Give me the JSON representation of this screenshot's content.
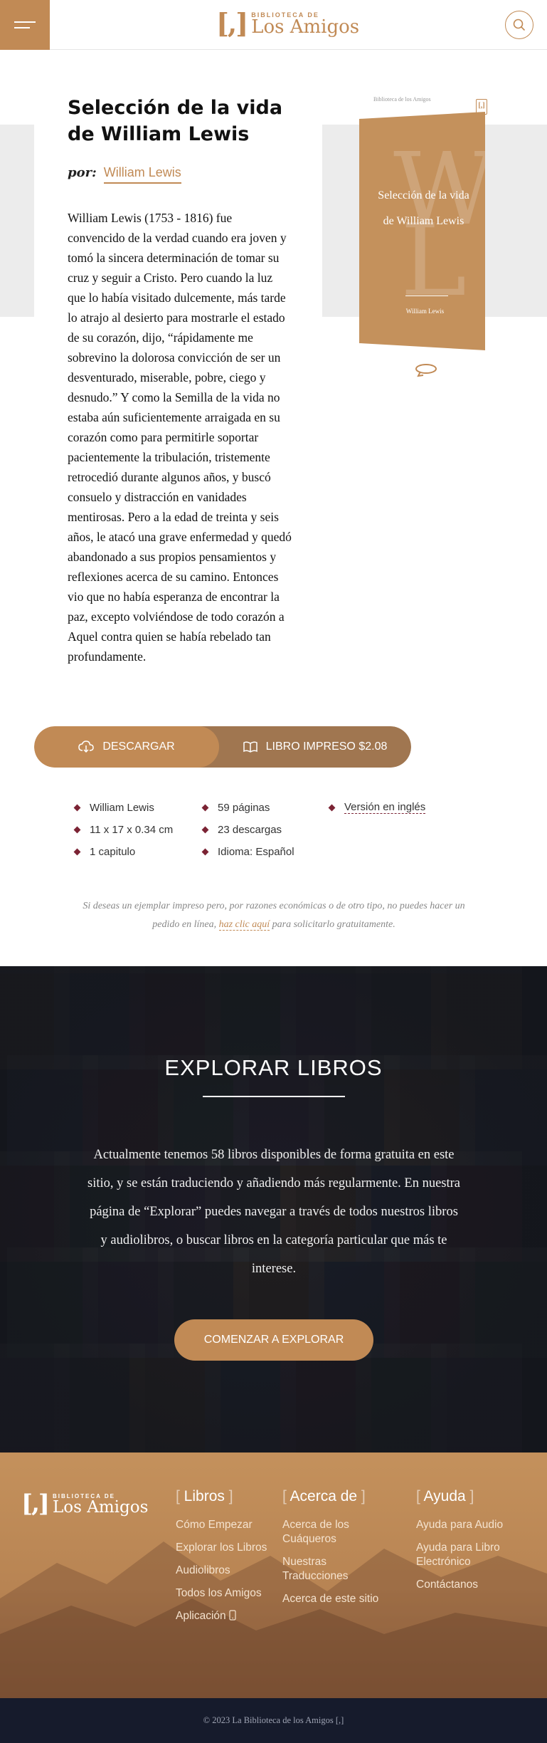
{
  "brand": {
    "small": "BIBLIOTECA DE",
    "big": "Los Amigos",
    "mark": "[,]",
    "color": "#c18a55"
  },
  "book": {
    "title": "Selección de la vida de William Lewis",
    "by": "por:",
    "author": "William Lewis",
    "description": "William Lewis (1753 - 1816) fue convencido de la verdad cuando era joven y tomó la sincera determinación de tomar su cruz y seguir a Cristo. Pero cuando la luz que lo había visitado dulcemente, más tarde lo atrajo al desierto para mostrarle el estado de su corazón, dijo, “rápidamente me sobrevino la dolorosa convicción de ser un desventurado, miserable, pobre, ciego y desnudo.” Y como la Semilla de la vida no estaba aún suficientemente arraigada en su corazón como para permitirle soportar pacientemente la tribulación, tristemente retrocedió durante algunos años, y buscó consuelo y distracción en vanidades mentirosas. Pero a la edad de treinta y seis años, le atacó una grave enfermedad y quedó abandonado a sus propios pensamientos y reflexiones acerca de su camino. Entonces vio que no había esperanza de encontrar la paz, excepto volviéndose de todo corazón a Aquel contra quien se había rebelado tan profundamente."
  },
  "cover": {
    "spine_text": "Biblioteca de los Amigos",
    "title": "Selección de la vida de William Lewis",
    "author": "William Lewis",
    "ghost_letters": [
      "W",
      "L"
    ]
  },
  "actions": {
    "download": "DESCARGAR",
    "print": "LIBRO IMPRESO $2.08"
  },
  "meta": [
    {
      "text": "William Lewis",
      "link": false
    },
    {
      "text": "59 páginas",
      "link": false
    },
    {
      "text": "Versión en inglés",
      "link": true
    },
    {
      "text": "11 x 17 x 0.34 cm",
      "link": false
    },
    {
      "text": "23 descargas",
      "link": false
    },
    {
      "text": "",
      "link": false
    },
    {
      "text": "1 capitulo",
      "link": false
    },
    {
      "text": "Idioma: Español",
      "link": false
    }
  ],
  "note": {
    "before": "Si deseas un ejemplar impreso pero, por razones económicas o de otro tipo, no puedes hacer un pedido en línea,",
    "link": "haz clic aquí",
    "after": "para solicitarlo gratuitamente."
  },
  "explore": {
    "title": "EXPLORAR LIBROS",
    "text": "Actualmente tenemos 58 libros disponibles de forma gratuita en este sitio, y se están traduciendo y añadiendo más regularmente. En nuestra página de “Explorar” puedes navegar a través de todos nuestros libros y audiolibros, o buscar libros en la categoría particular que más te interese.",
    "button": "COMENZAR A EXPLORAR"
  },
  "footer": {
    "columns": [
      {
        "title": "Libros",
        "links": [
          "Cómo Empezar",
          "Explorar los Libros",
          "Audiolibros",
          "Todos los Amigos",
          "Aplicación"
        ]
      },
      {
        "title": "Acerca de",
        "links": [
          "Acerca de los Cuáqueros",
          "Nuestras Traducciones",
          "Acerca de este sitio"
        ]
      },
      {
        "title": "Ayuda",
        "links": [
          "Ayuda para Audio",
          "Ayuda para Libro Electrónico",
          "Contáctanos"
        ]
      }
    ],
    "copyright": "© 2023 La Biblioteca de los Amigos [,]"
  }
}
